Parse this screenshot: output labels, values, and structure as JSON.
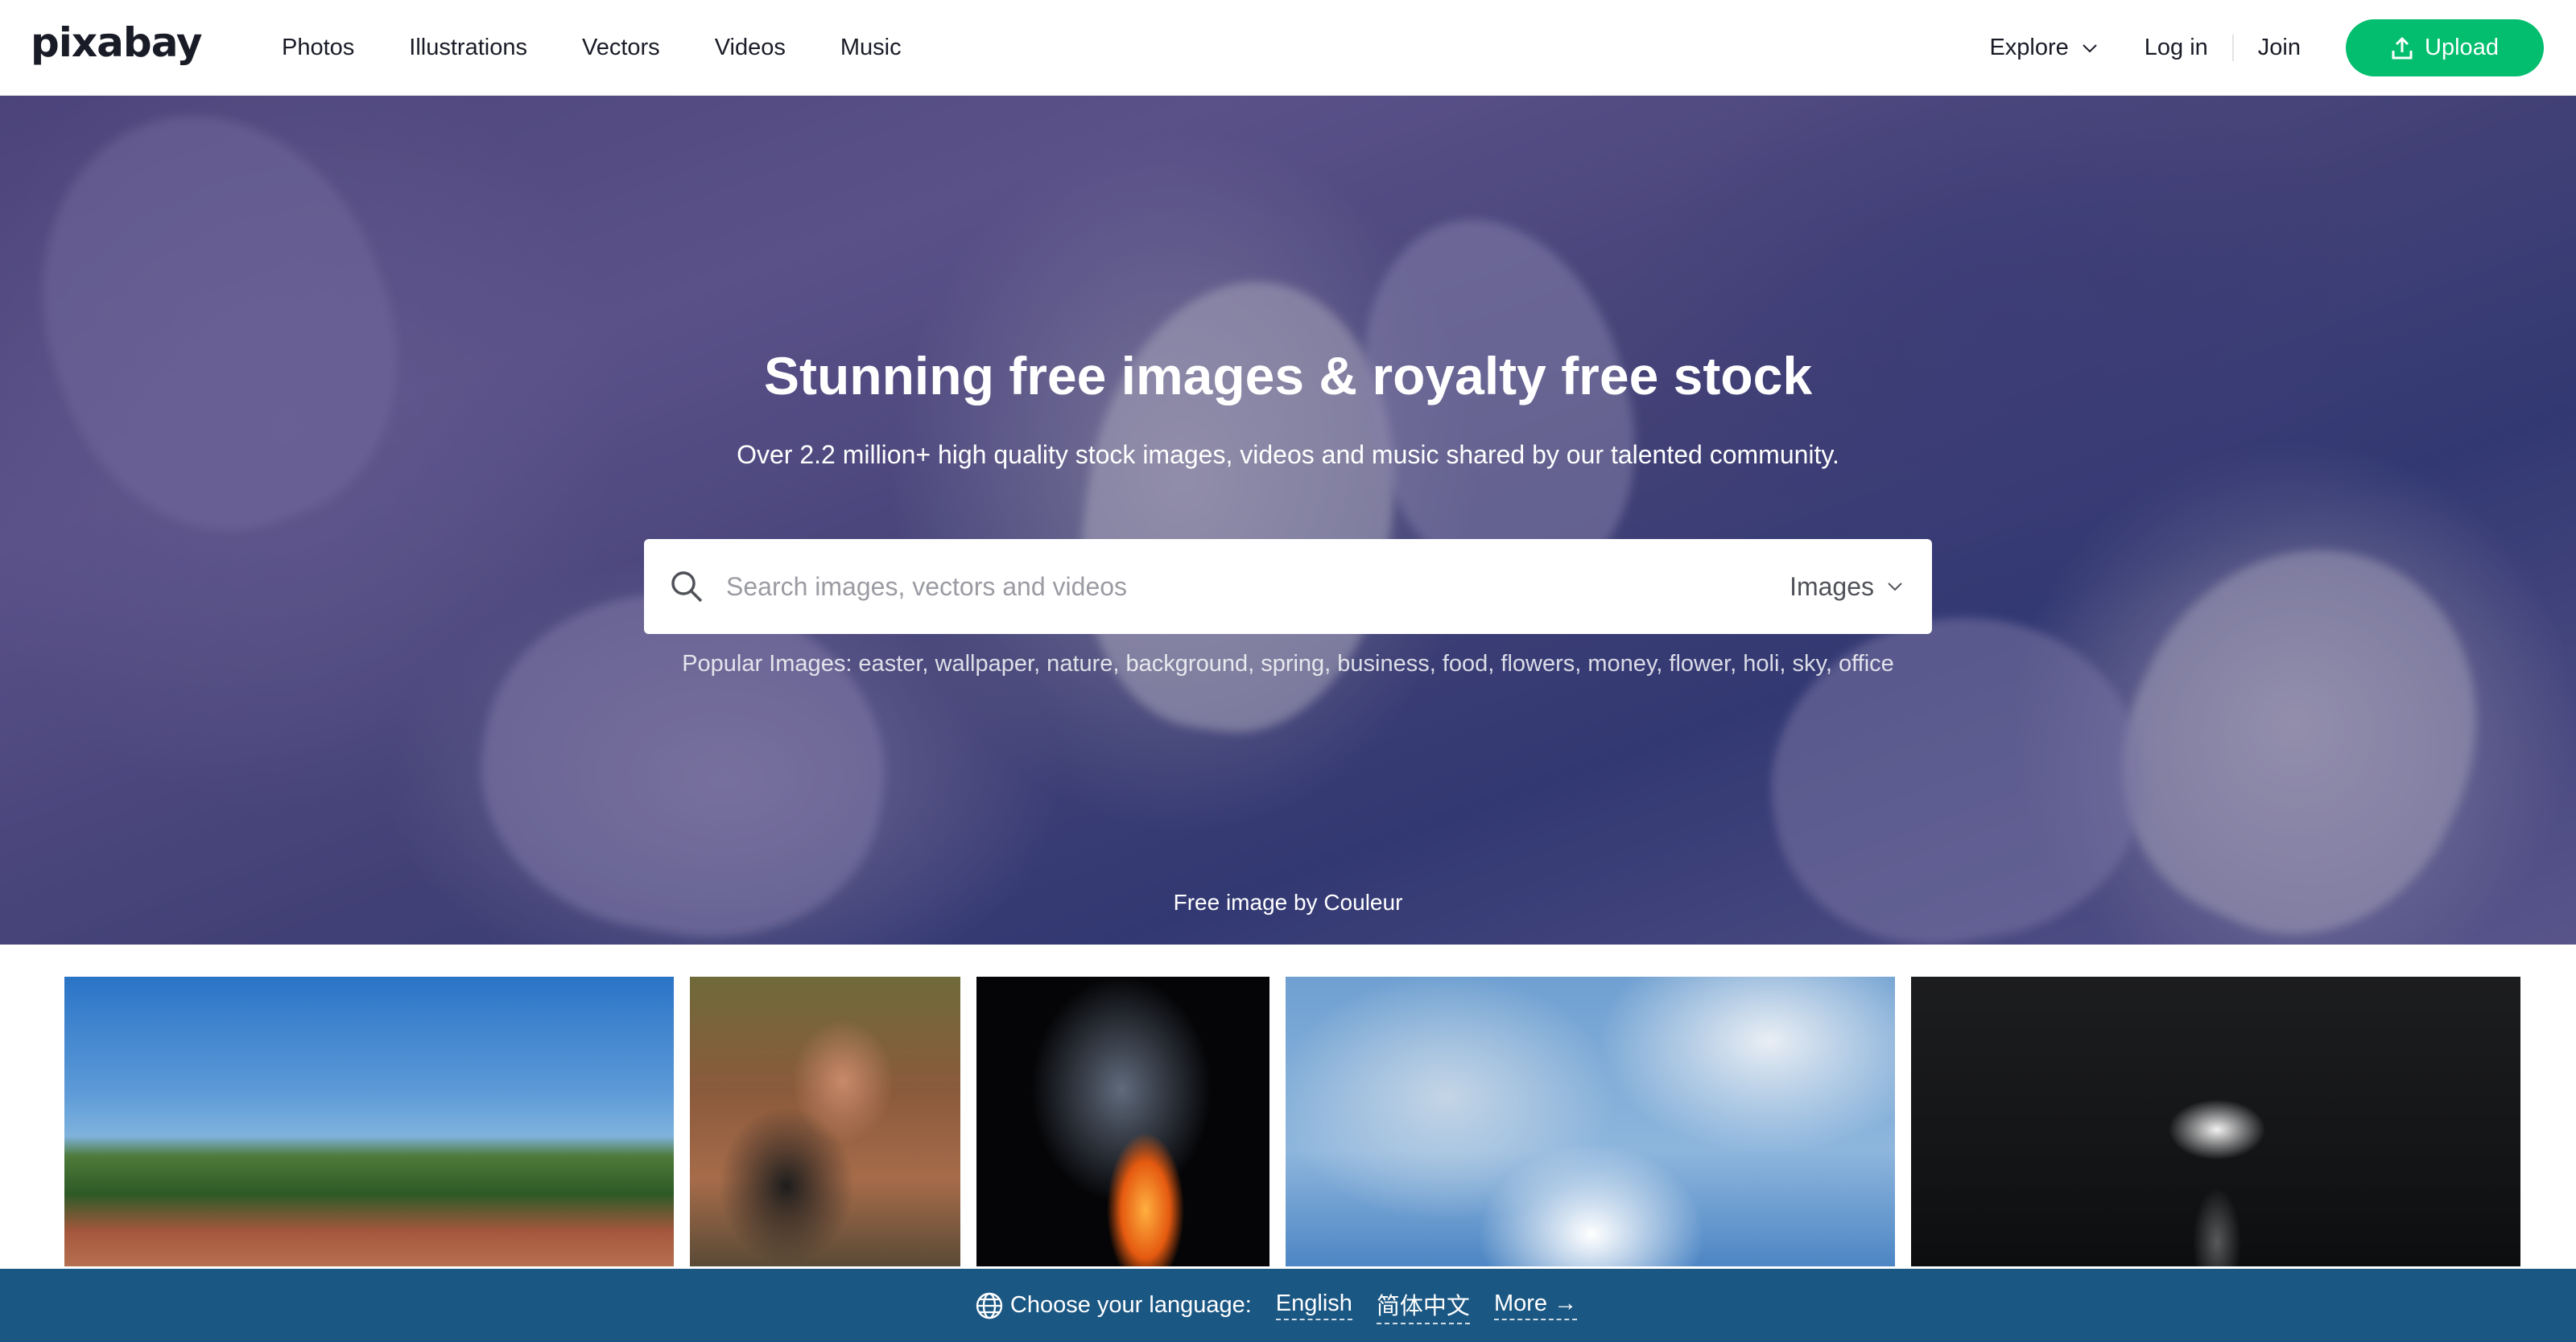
{
  "header": {
    "logo": "pixabay",
    "nav": [
      "Photos",
      "Illustrations",
      "Vectors",
      "Videos",
      "Music"
    ],
    "explore_label": "Explore",
    "login_label": "Log in",
    "join_label": "Join",
    "upload_label": "Upload",
    "accent_color": "#02be6e"
  },
  "hero": {
    "title": "Stunning free images & royalty free stock",
    "subtitle": "Over 2.2 million+ high quality stock images, videos and music shared by our talented community.",
    "search_placeholder": "Search images, vectors and videos",
    "search_type": "Images",
    "popular_text": "Popular Images: easter, wallpaper, nature, background, spring, business, food, flowers, money, flower, holi, sky, office",
    "credit": "Free image by Couleur"
  },
  "language_bar": {
    "label": "Choose your language:",
    "languages": [
      "English",
      "简体中文"
    ],
    "more": "More →",
    "background": "#1b5783"
  }
}
